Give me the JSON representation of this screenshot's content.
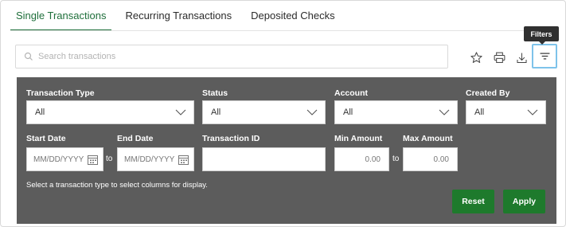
{
  "tabs": [
    {
      "label": "Single Transactions",
      "active": true
    },
    {
      "label": "Recurring Transactions",
      "active": false
    },
    {
      "label": "Deposited Checks",
      "active": false
    }
  ],
  "search": {
    "placeholder": "Search transactions",
    "icon": "search-icon"
  },
  "toolbar": {
    "icons": [
      "star-icon",
      "print-icon",
      "download-icon",
      "filter-icon"
    ],
    "tooltip": "Filters"
  },
  "filters": {
    "transaction_type": {
      "label": "Transaction Type",
      "value": "All"
    },
    "status": {
      "label": "Status",
      "value": "All"
    },
    "account": {
      "label": "Account",
      "value": "All"
    },
    "created_by": {
      "label": "Created By",
      "value": "All"
    },
    "start_date": {
      "label": "Start Date",
      "placeholder": "MM/DD/YYYY"
    },
    "end_date": {
      "label": "End Date",
      "placeholder": "MM/DD/YYYY"
    },
    "range_separator": "to",
    "transaction_id": {
      "label": "Transaction ID",
      "value": ""
    },
    "min_amount": {
      "label": "Min Amount",
      "placeholder": "0.00"
    },
    "max_amount": {
      "label": "Max Amount",
      "placeholder": "0.00"
    },
    "note": "Select a transaction type to select columns for display.",
    "reset_label": "Reset",
    "apply_label": "Apply"
  },
  "colors": {
    "accent": "#1f6f3b",
    "panel_bg": "#5c5c5c",
    "button": "#1e7a2c",
    "focus": "#7ec3ea"
  }
}
